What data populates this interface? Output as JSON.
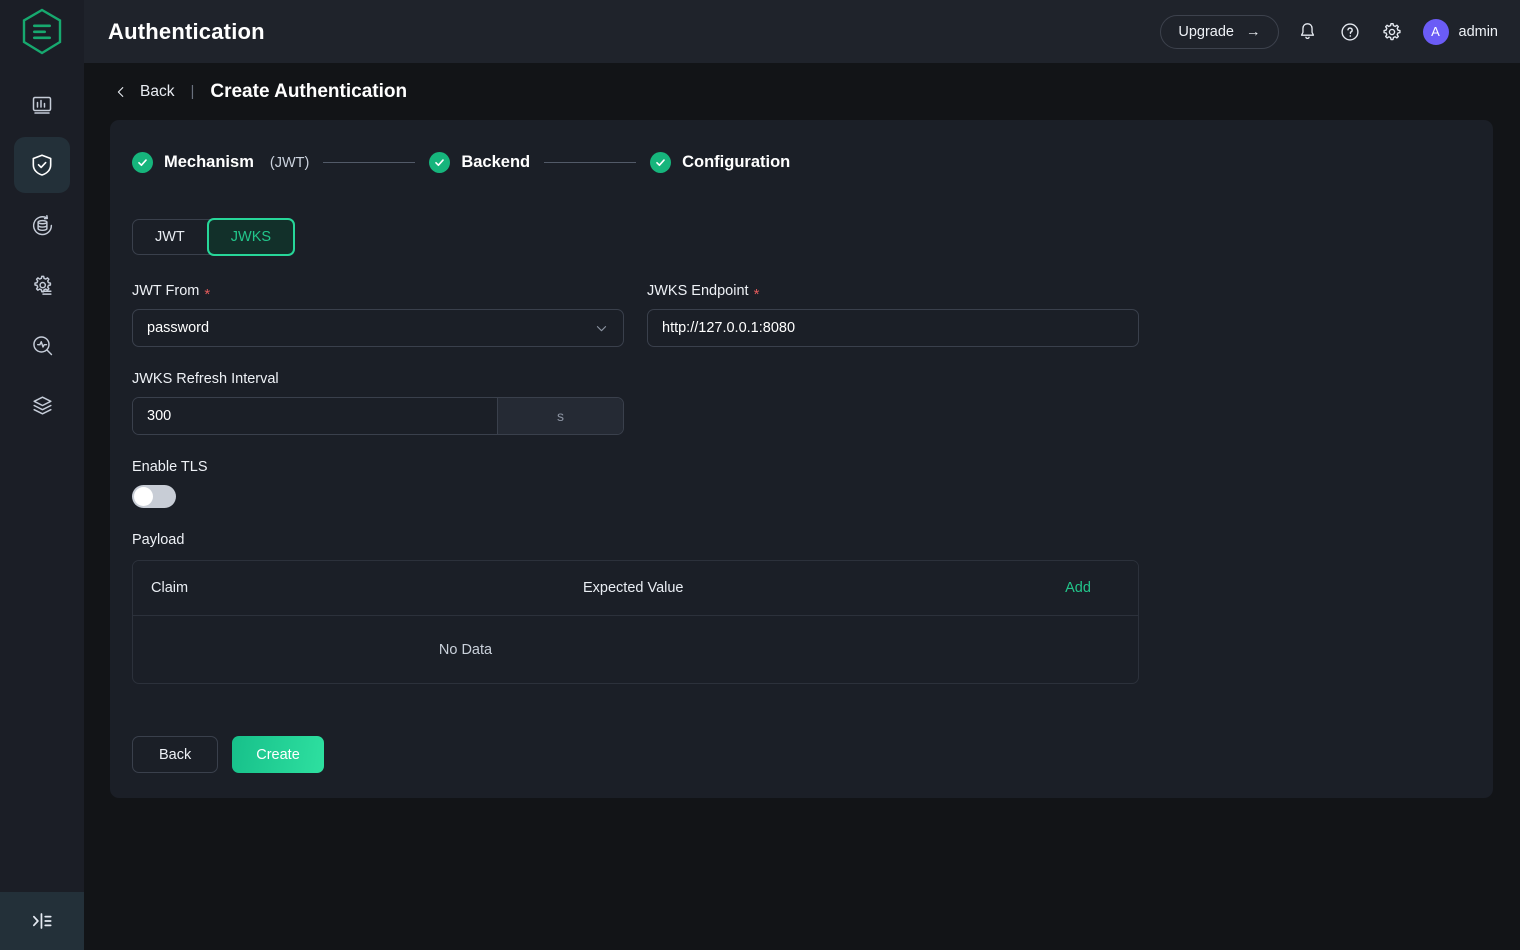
{
  "sidebar": {
    "logo_name": "emqx-hexagon-logo",
    "items": [
      {
        "name": "dashboard",
        "icon": "chart-bar-icon",
        "active": false
      },
      {
        "name": "authentication",
        "icon": "shield-check-icon",
        "active": true
      },
      {
        "name": "data-integration",
        "icon": "database-refresh-icon",
        "active": false
      },
      {
        "name": "management",
        "icon": "gear-list-icon",
        "active": false
      },
      {
        "name": "diagnose",
        "icon": "magnifier-pulse-icon",
        "active": false
      },
      {
        "name": "clustering",
        "icon": "layers-stack-icon",
        "active": false
      }
    ],
    "collapse_icon": "panel-collapse-icon"
  },
  "header": {
    "title": "Authentication",
    "upgrade_label": "Upgrade",
    "upgrade_arrow": "→",
    "bell_icon": "bell-icon",
    "help_icon": "question-circle-icon",
    "settings_icon": "gear-icon",
    "avatar_initial": "A",
    "user_name": "admin"
  },
  "breadcrumb": {
    "back_label": "Back",
    "separator": "|",
    "title": "Create Authentication"
  },
  "stepper": {
    "steps": [
      {
        "label": "Mechanism",
        "sub": "(JWT)",
        "done": true
      },
      {
        "label": "Backend",
        "sub": "",
        "done": true
      },
      {
        "label": "Configuration",
        "sub": "",
        "done": true
      }
    ]
  },
  "tabs": {
    "items": [
      {
        "label": "JWT",
        "active": false
      },
      {
        "label": "JWKS",
        "active": true
      }
    ]
  },
  "form": {
    "jwt_from": {
      "label": "JWT From",
      "required": "*",
      "value": "password",
      "chevron": "chevron-down-icon"
    },
    "jwks_endpoint": {
      "label": "JWKS Endpoint",
      "required": "*",
      "value": "http://127.0.0.1:8080"
    },
    "jwks_refresh_interval": {
      "label": "JWKS Refresh Interval",
      "value": "300",
      "unit": "s"
    },
    "enable_tls": {
      "label": "Enable TLS",
      "state": "off"
    },
    "payload": {
      "label": "Payload",
      "columns": [
        "Claim",
        "Expected Value"
      ],
      "add_label": "Add",
      "empty_text": "No Data",
      "rows": []
    }
  },
  "actions": {
    "back_label": "Back",
    "create_label": "Create"
  },
  "colors": {
    "accent_green": "#22c58a",
    "step_green": "#16b57c",
    "required_red": "#e35b5b",
    "avatar_purple": "#6b5cf6",
    "card_bg": "#1b1f27",
    "page_bg": "#121417",
    "sidebar_bg": "#1b1e26"
  }
}
